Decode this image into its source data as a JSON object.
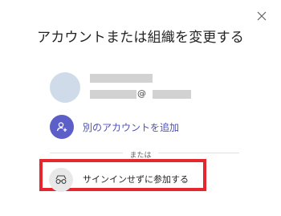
{
  "dialog": {
    "title": "アカウントまたは組織を変更する",
    "close_icon": "close-icon"
  },
  "account": {
    "at_sign": "@",
    "avatar_color": "#cfdbe9"
  },
  "actions": {
    "add_account_label": "別のアカウントを追加",
    "add_account_icon": "add-person-icon",
    "or_label": "または",
    "join_without_signin_label": "サインインせずに参加する",
    "join_icon": "anonymous-glasses-icon",
    "highlight_color": "#e5262d",
    "accent_color": "#5b5fc7"
  }
}
